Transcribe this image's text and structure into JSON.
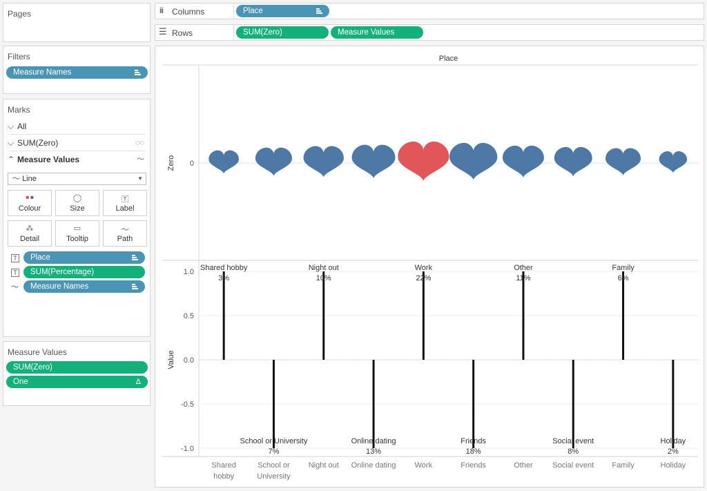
{
  "pages": {
    "title": "Pages"
  },
  "filters": {
    "title": "Filters",
    "pills": [
      {
        "label": "Measure Names"
      }
    ]
  },
  "marks": {
    "title": "Marks",
    "rows": [
      {
        "label": "All"
      },
      {
        "label": "SUM(Zero)"
      },
      {
        "label": "Measure Values"
      }
    ],
    "mark_type": "Line",
    "cards": [
      {
        "label": "Colour",
        "icon": "colour-icon"
      },
      {
        "label": "Size",
        "icon": "size-icon"
      },
      {
        "label": "Label",
        "icon": "label-icon"
      },
      {
        "label": "Detail",
        "icon": "detail-icon"
      },
      {
        "label": "Tooltip",
        "icon": "tooltip-icon"
      },
      {
        "label": "Path",
        "icon": "path-icon"
      }
    ],
    "fields": [
      {
        "label": "Place",
        "color": "#4a94b5"
      },
      {
        "label": "SUM(Percentage)",
        "color": "#13b07c"
      },
      {
        "label": "Measure Names",
        "color": "#4a94b5"
      }
    ]
  },
  "measure_values": {
    "title": "Measure Values",
    "pills": [
      {
        "label": "SUM(Zero)"
      },
      {
        "label": "One",
        "badge": "Δ"
      }
    ]
  },
  "shelves": {
    "columns": {
      "label": "Columns",
      "pills": [
        "Place"
      ]
    },
    "rows": {
      "label": "Rows",
      "pills": [
        "SUM(Zero)",
        "Measure Values"
      ]
    }
  },
  "colors": {
    "heart": "#4e79a7",
    "highlight": "#e15759",
    "pill_blue": "#4a94b5",
    "pill_green": "#13b07c"
  },
  "chart_data": [
    {
      "type": "scatter",
      "title": "Place",
      "ylabel": "Zero",
      "yticks": [
        "0"
      ],
      "mark": "heart",
      "categories": [
        "Shared hobby",
        "School or University",
        "Night out",
        "Online dating",
        "Work",
        "Friends",
        "Other",
        "Social event",
        "Family",
        "Holiday"
      ],
      "values": [
        0,
        0,
        0,
        0,
        0,
        0,
        0,
        0,
        0,
        0
      ],
      "size_by": [
        3,
        7,
        10,
        13,
        22,
        18,
        11,
        8,
        6,
        2
      ],
      "highlight": "Work"
    },
    {
      "type": "bar",
      "ylabel": "Value",
      "ylim": [
        -1.0,
        1.0
      ],
      "yticks": [
        "1.0",
        "0.5",
        "0.0",
        "-0.5",
        "-1.0"
      ],
      "categories": [
        "Shared hobby",
        "School or University",
        "Night out",
        "Online dating",
        "Work",
        "Friends",
        "Other",
        "Social event",
        "Family",
        "Holiday"
      ],
      "xtick_labels": [
        [
          "Shared",
          "hobby"
        ],
        [
          "School or",
          "University"
        ],
        [
          "Night out"
        ],
        [
          "Online dating"
        ],
        [
          "Work"
        ],
        [
          "Friends"
        ],
        [
          "Other"
        ],
        [
          "Social event"
        ],
        [
          "Family"
        ],
        [
          "Holiday"
        ]
      ],
      "values": [
        1,
        -1,
        1,
        -1,
        1,
        -1,
        1,
        -1,
        1,
        -1
      ],
      "labels": [
        "3%",
        "7%",
        "10%",
        "13%",
        "22%",
        "18%",
        "11%",
        "8%",
        "6%",
        "2%"
      ],
      "grid": true
    }
  ]
}
